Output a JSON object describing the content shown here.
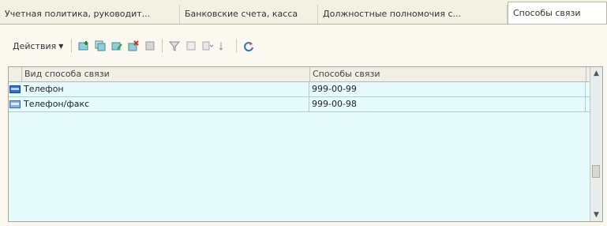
{
  "tabs": [
    {
      "label": "Учетная политика, руководит..."
    },
    {
      "label": "Банковские счета, касса"
    },
    {
      "label": "Должностные полномочия с..."
    },
    {
      "label": "Способы связи"
    }
  ],
  "toolbar": {
    "actions_label": "Действия",
    "icons": [
      "add-icon",
      "copy-icon",
      "edit-icon",
      "delete-icon",
      "mark-icon",
      "filter-icon",
      "filter-off-icon",
      "hierarchy-icon",
      "sort-icon",
      "refresh-icon"
    ]
  },
  "table": {
    "columns": [
      "Вид способа связи",
      "Способы связи"
    ],
    "rows": [
      {
        "type": "Телефон",
        "value": "999-00-99",
        "icon": "phone-icon"
      },
      {
        "type": "Телефон/факс",
        "value": "999-00-98",
        "icon": "fax-icon"
      }
    ]
  },
  "colors": {
    "grid_bg": "#e6fbfb",
    "accent": "#2f6fd6"
  }
}
